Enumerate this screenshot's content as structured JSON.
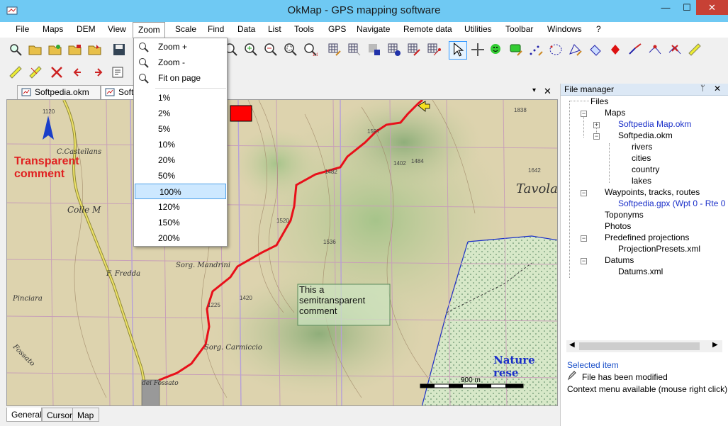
{
  "window": {
    "title": "OkMap - GPS mapping software",
    "minimize": "—",
    "maximize": "☐",
    "close": "✕"
  },
  "menu": [
    "File",
    "Maps",
    "DEM",
    "View",
    "Zoom",
    "Scale",
    "Find",
    "Data",
    "List",
    "Tools",
    "GPS",
    "Navigate",
    "Remote data",
    "Utilities",
    "Toolbar",
    "Windows",
    "?"
  ],
  "tabs": {
    "tab1": "Softpedia.okm",
    "tab2": "Softpedia.okm",
    "close": "✕",
    "pin": "▾"
  },
  "zoom_menu": {
    "zoom_in": "Zoom +",
    "zoom_out": "Zoom -",
    "fit": "Fit on page",
    "levels": [
      "1%",
      "2%",
      "5%",
      "10%",
      "20%",
      "50%",
      "100%",
      "120%",
      "150%",
      "200%"
    ],
    "selected": "100%"
  },
  "map": {
    "comment_transparent_line1": "Transparent",
    "comment_transparent_line2": "comment",
    "comment_semi_line1": "This a",
    "comment_semi_line2": "semitransparent",
    "comment_semi_line3": "comment",
    "nature": "Nature rese",
    "scale_label": "900 m",
    "places": [
      "C.Castellans",
      "Colle M",
      "F. Fredda",
      "Sorg. Mandrini",
      "Sorg. Carmiccio",
      "Fossato",
      "Pinciara",
      "Tavola",
      "dei Fossato"
    ],
    "elevations": [
      "1120",
      "1597",
      "1482",
      "1520",
      "1536",
      "1420",
      "1225",
      "1536",
      "1402",
      "1484",
      "1838",
      "1642",
      "1480",
      "1590"
    ]
  },
  "bottom_tabs": [
    "General",
    "Cursor",
    "Map"
  ],
  "file_manager": {
    "title": "File manager",
    "pin": "ᛘ",
    "close": "✕",
    "tree": {
      "files": "Files",
      "maps": "Maps",
      "map1": "Softpedia Map.okm",
      "map2": "Softpedia.okm",
      "rivers": "rivers",
      "cities": "cities",
      "country": "country",
      "lakes": "lakes",
      "wpt": "Waypoints, tracks, routes",
      "gpx": "Softpedia.gpx (Wpt 0 - Rte 0 - T",
      "toponyms": "Toponyms",
      "photos": "Photos",
      "projections": "Predefined projections",
      "projfile": "ProjectionPresets.xml",
      "datums": "Datums",
      "datumfile": "Datums.xml"
    },
    "status": {
      "selected": "Selected item",
      "modified": "File has been modified",
      "context": "Context menu available (mouse right click)"
    }
  },
  "colors": {
    "title_bg": "#6fc9f3",
    "track": "#e8101a",
    "accent": "#1a2fc9"
  }
}
